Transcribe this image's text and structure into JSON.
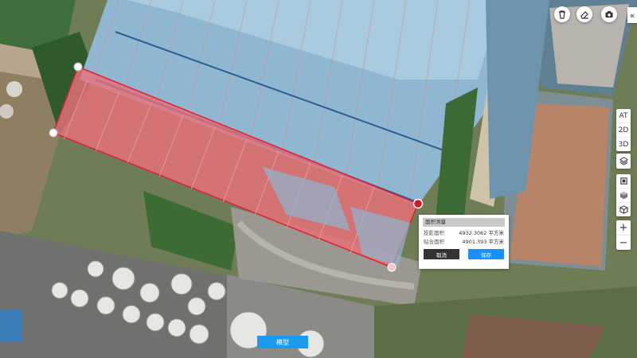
{
  "toolbar": {
    "icons": [
      "trash-icon",
      "eraser-icon",
      "camera-icon"
    ],
    "collapse_label": "«"
  },
  "view_modes": [
    "AT",
    "2D",
    "3D"
  ],
  "layer_buttons": [
    "layers-icon",
    "box-icon",
    "cube-icon",
    "stack-icon"
  ],
  "zoom": {
    "in_label": "+",
    "out_label": "−"
  },
  "measure_popup": {
    "title": "面积测量",
    "rows": [
      {
        "label": "投影面积",
        "value": "4932.3062 平方米"
      },
      {
        "label": "贴合面积",
        "value": "4901.393 平方米"
      }
    ],
    "cancel_label": "取消",
    "save_label": "保存"
  },
  "model_button_label": "模型",
  "colors": {
    "measure_fill": "#e8707a",
    "measure_stroke": "#e0202e",
    "roof_blue": "#8fb7d2",
    "primary": "#1890ff"
  }
}
